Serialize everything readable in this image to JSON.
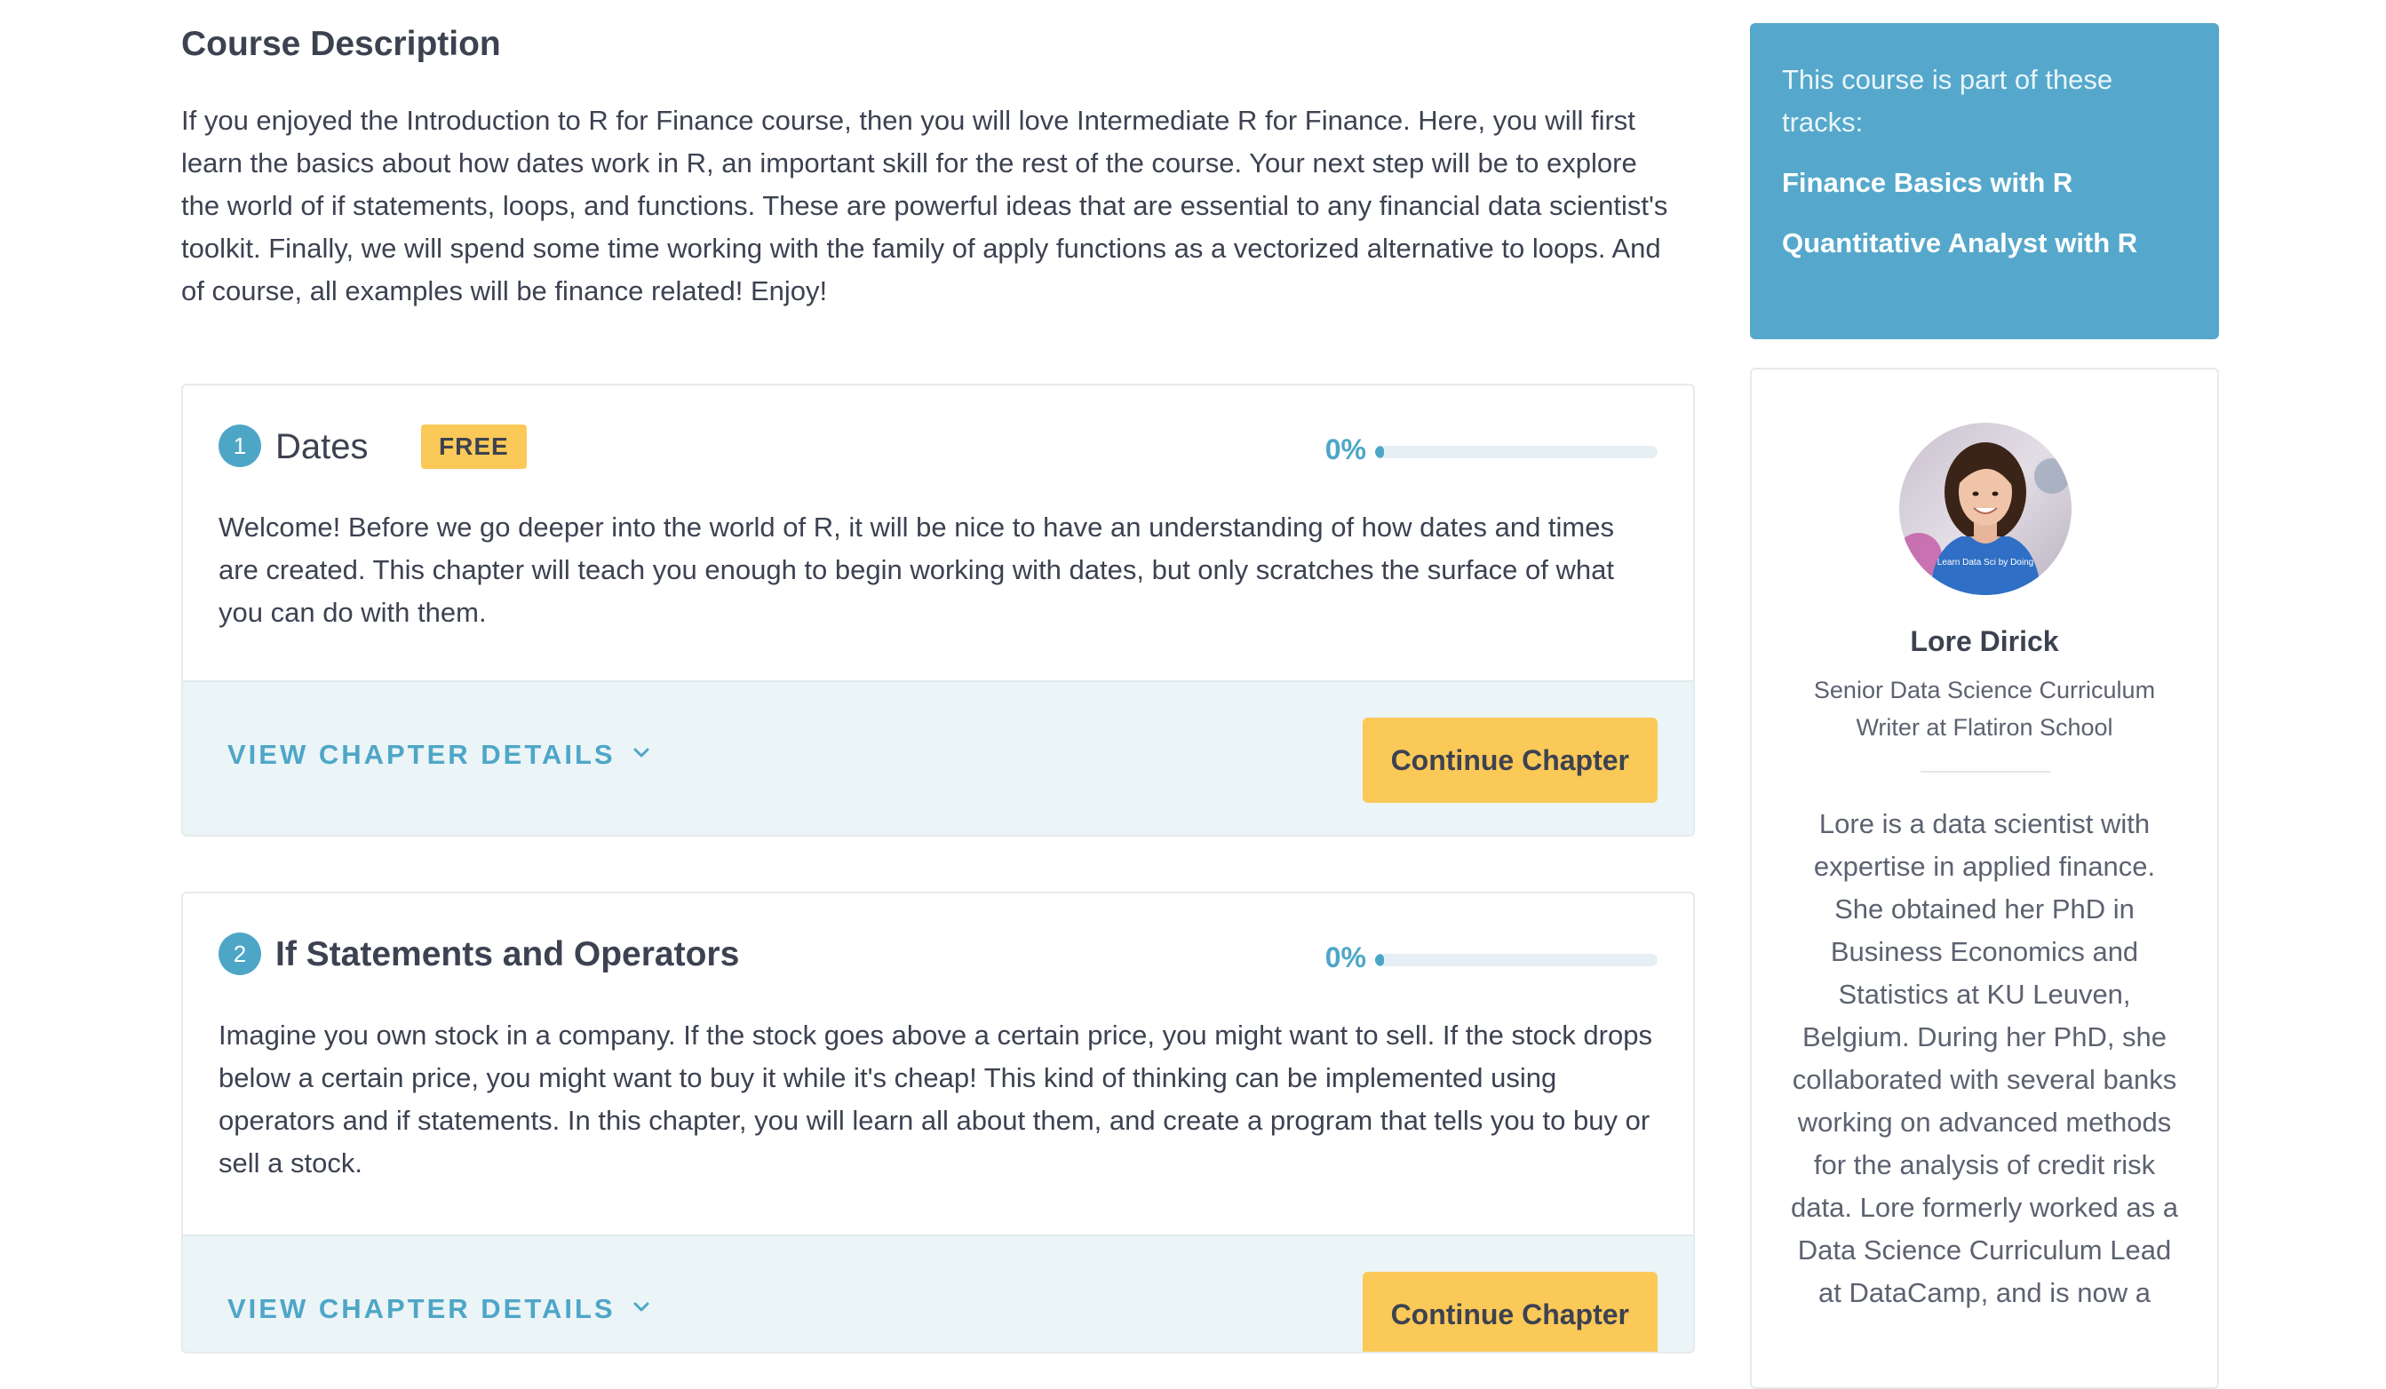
{
  "course_description": {
    "heading": "Course Description",
    "text": "If you enjoyed the Introduction to R for Finance course, then you will love Intermediate R for Finance. Here, you will first learn the basics about how dates work in R, an important skill for the rest of the course. Your next step will be to explore the world of if statements, loops, and functions. These are powerful ideas that are essential to any financial data scientist's toolkit. Finally, we will spend some time working with the family of apply functions as a vectorized alternative to loops. And of course, all examples will be finance related! Enjoy!"
  },
  "chapters": [
    {
      "number": "1",
      "title": "Dates",
      "badge": "FREE",
      "progress_label": "0%",
      "progress": 0,
      "description": "Welcome! Before we go deeper into the world of R, it will be nice to have an understanding of how dates and times are created. This chapter will teach you enough to begin working with dates, but only scratches the surface of what you can do with them.",
      "details_label": "VIEW CHAPTER DETAILS",
      "button_label": "Continue Chapter"
    },
    {
      "number": "2",
      "title": "If Statements and Operators",
      "progress_label": "0%",
      "progress": 0,
      "description": "Imagine you own stock in a company. If the stock goes above a certain price, you might want to sell. If the stock drops below a certain price, you might want to buy it while it's cheap! This kind of thinking can be implemented using operators and if statements. In this chapter, you will learn all about them, and create a program that tells you to buy or sell a stock.",
      "details_label": "VIEW CHAPTER DETAILS",
      "button_label": "Continue Chapter"
    }
  ],
  "tracks": {
    "intro": "This course is part of these tracks:",
    "items": [
      "Finance Basics with R",
      "Quantitative Analyst with R"
    ]
  },
  "instructor": {
    "name": "Lore Dirick",
    "title": "Senior Data Science Curriculum Writer at Flatiron School",
    "shirt_text": "Learn Data Sci by Doing",
    "bio": "Lore is a data scientist with expertise in applied finance. She obtained her PhD in Business Economics and Statistics at KU Leuven, Belgium. During her PhD, she collaborated with several banks working on advanced methods for the analysis of credit risk data. Lore formerly worked as a Data Science Curriculum Lead at DataCamp, and is now a"
  },
  "colors": {
    "accent": "#4ea6c7",
    "tracks_bg": "#55a8cb",
    "button": "#fbc957",
    "footer_bg": "#ebf4f7",
    "text": "#3d4251"
  }
}
